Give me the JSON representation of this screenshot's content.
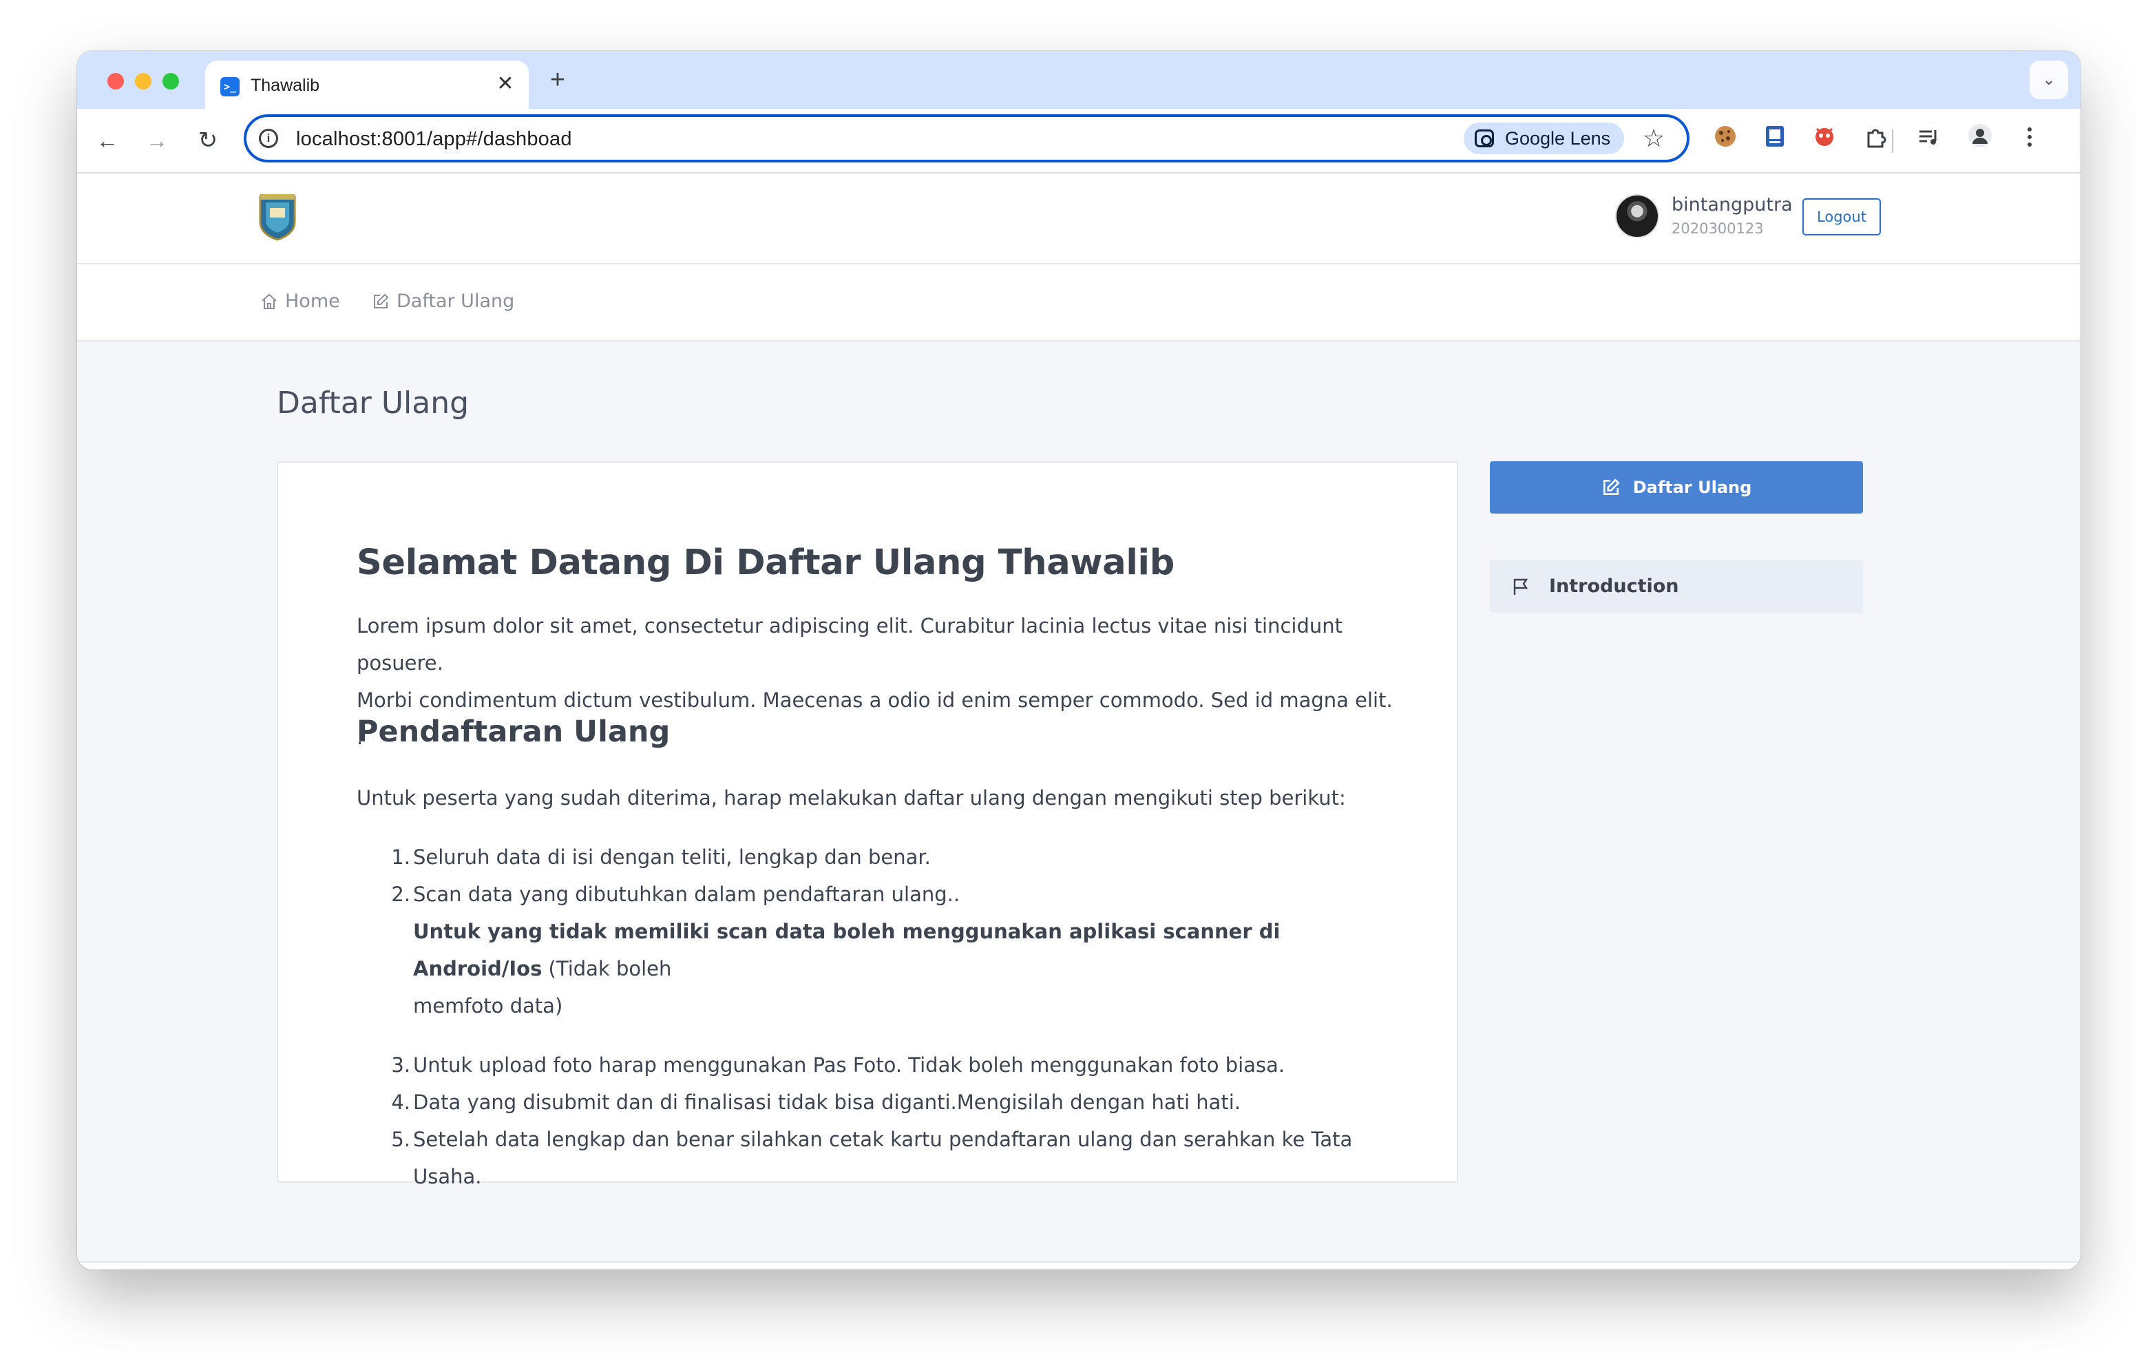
{
  "browser": {
    "tab_title": "Thawalib",
    "url": "localhost:8001/app#/dashboad",
    "lens_label": "Google Lens"
  },
  "header": {
    "username": "bintangputra",
    "user_id": "2020300123",
    "logout_label": "Logout"
  },
  "nav": {
    "items": [
      {
        "label": "Home",
        "icon": "home-icon"
      },
      {
        "label": "Daftar Ulang",
        "icon": "edit-icon"
      }
    ]
  },
  "page": {
    "title": "Daftar Ulang"
  },
  "card": {
    "heading": "Selamat Datang Di Daftar Ulang Thawalib",
    "paragraph_line1": "Lorem ipsum dolor sit amet, consectetur adipiscing elit. Curabitur lacinia lectus vitae nisi tincidunt posuere.",
    "paragraph_line2": "Morbi condimentum dictum vestibulum. Maecenas a odio id enim semper commodo. Sed id magna elit. .",
    "subheading": "Pendaftaran Ulang",
    "intro": "Untuk peserta yang sudah diterima, harap melakukan daftar ulang dengan mengikuti step berikut:",
    "steps": [
      {
        "num": "1.",
        "text": "Seluruh data di isi dengan teliti, lengkap dan benar."
      },
      {
        "num": "2.",
        "text": "Scan data yang dibutuhkan dalam pendaftaran ulang..",
        "bold_note": "Untuk yang tidak memiliki scan data boleh menggunakan aplikasi scanner di Android/Ios",
        "note_rest": " (Tidak boleh",
        "note_line2": "memfoto data)"
      },
      {
        "num": "3.",
        "text": "Untuk upload foto harap menggunakan Pas Foto. Tidak boleh menggunakan foto biasa."
      },
      {
        "num": "4.",
        "text": "Data yang disubmit dan di finalisasi tidak bisa diganti.Mengisilah dengan hati hati."
      },
      {
        "num": "5.",
        "text": "Setelah data lengkap dan benar silahkan cetak kartu pendaftaran ulang dan serahkan ke Tata Usaha."
      }
    ]
  },
  "sidebar": {
    "button_label": "Daftar Ulang",
    "items": [
      {
        "label": "Introduction",
        "icon": "flag-icon"
      }
    ]
  },
  "colors": {
    "primary": "#4a82d4",
    "browser_accent": "#0b57d0",
    "tabstrip": "#d3e3fd",
    "page_bg": "#f4f6f9"
  }
}
